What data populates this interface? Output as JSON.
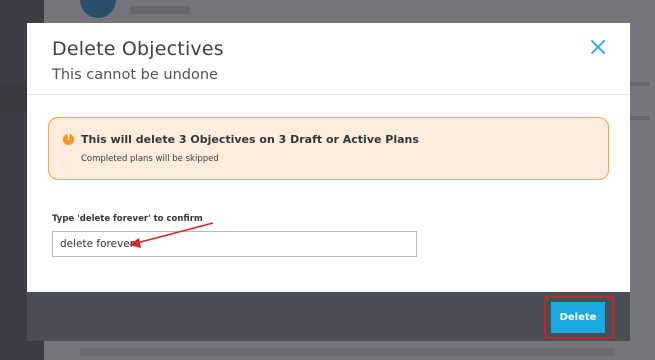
{
  "modal": {
    "title": "Delete Objectives",
    "subtitle": "This cannot be undone",
    "close_icon": "close-icon"
  },
  "alert": {
    "icon": "warning-icon",
    "title": "This will delete 3 Objectives on 3 Draft or Active Plans",
    "body": "Completed plans will be skipped",
    "accent_color": "#f5a447"
  },
  "confirm": {
    "label": "Type 'delete forever' to confirm",
    "value": "delete forever"
  },
  "footer": {
    "delete_label": "Delete",
    "delete_color": "#1ba8df",
    "highlight_color": "#c0272d"
  }
}
